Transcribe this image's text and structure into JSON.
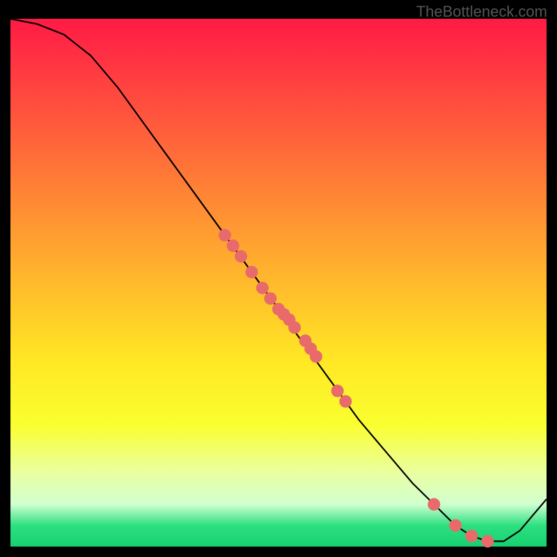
{
  "watermark": "TheBottleneck.com",
  "chart_data": {
    "type": "line",
    "title": "",
    "xlabel": "",
    "ylabel": "",
    "xlim": [
      0,
      100
    ],
    "ylim": [
      0,
      100
    ],
    "curve": {
      "x": [
        0,
        5,
        10,
        15,
        20,
        25,
        30,
        35,
        40,
        45,
        50,
        55,
        60,
        65,
        70,
        75,
        80,
        83,
        86,
        89,
        92,
        95,
        100
      ],
      "y": [
        100,
        99,
        97,
        93,
        87,
        80,
        73,
        66,
        59,
        52,
        45,
        38,
        31,
        24,
        18,
        12,
        7,
        4,
        2,
        1,
        1,
        3,
        9
      ]
    },
    "markers": {
      "x": [
        40,
        41.5,
        43,
        45,
        47,
        48.5,
        50,
        51,
        52,
        53,
        55,
        56,
        57,
        61,
        62.5,
        79,
        83,
        86,
        89
      ],
      "y": [
        59,
        57,
        55,
        52,
        49,
        47,
        45,
        44,
        43,
        41.5,
        39,
        37.5,
        36,
        29.5,
        27.5,
        8,
        4,
        2,
        1
      ]
    },
    "background_gradient": {
      "top": "#ff1a44",
      "mid": "#ffe824",
      "bottom": "#18d070"
    }
  }
}
